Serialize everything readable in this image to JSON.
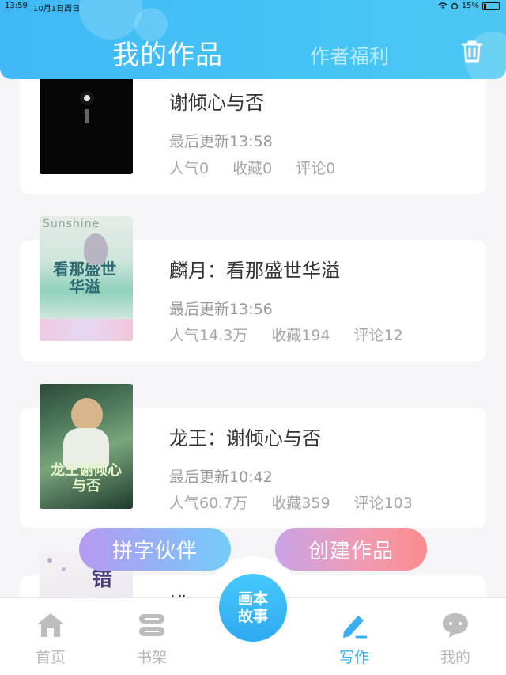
{
  "status_bar": {
    "time": "13:59",
    "date": "10月1日周日",
    "battery": "15%"
  },
  "header": {
    "title": "我的作品",
    "tab_welfare": "作者福利"
  },
  "works": [
    {
      "title": "谢倾心与否",
      "updated": "最后更新13:58",
      "popularity": "人气0",
      "favorites": "收藏0",
      "comments": "评论0"
    },
    {
      "title": "麟月：看那盛世华溢",
      "updated": "最后更新13:56",
      "popularity": "人气14.3万",
      "favorites": "收藏194",
      "comments": "评论12",
      "cover_text": "Sunshine",
      "cover_title": "看那盛世华溢"
    },
    {
      "title": "龙王：谢倾心与否",
      "updated": "最后更新10:42",
      "popularity": "人气60.7万",
      "favorites": "收藏359",
      "comments": "评论103",
      "cover_title": "龙王谢倾心与否"
    },
    {
      "title": "错",
      "cover_title": "错"
    }
  ],
  "floating": {
    "partner": "拼字伙伴",
    "create": "创建作品"
  },
  "tabbar": {
    "home": "首页",
    "shelf": "书架",
    "center_line1": "画本",
    "center_line2": "故事",
    "write": "写作",
    "mine": "我的"
  },
  "colors": {
    "accent": "#3aaef0",
    "header": "#44c4f6"
  }
}
